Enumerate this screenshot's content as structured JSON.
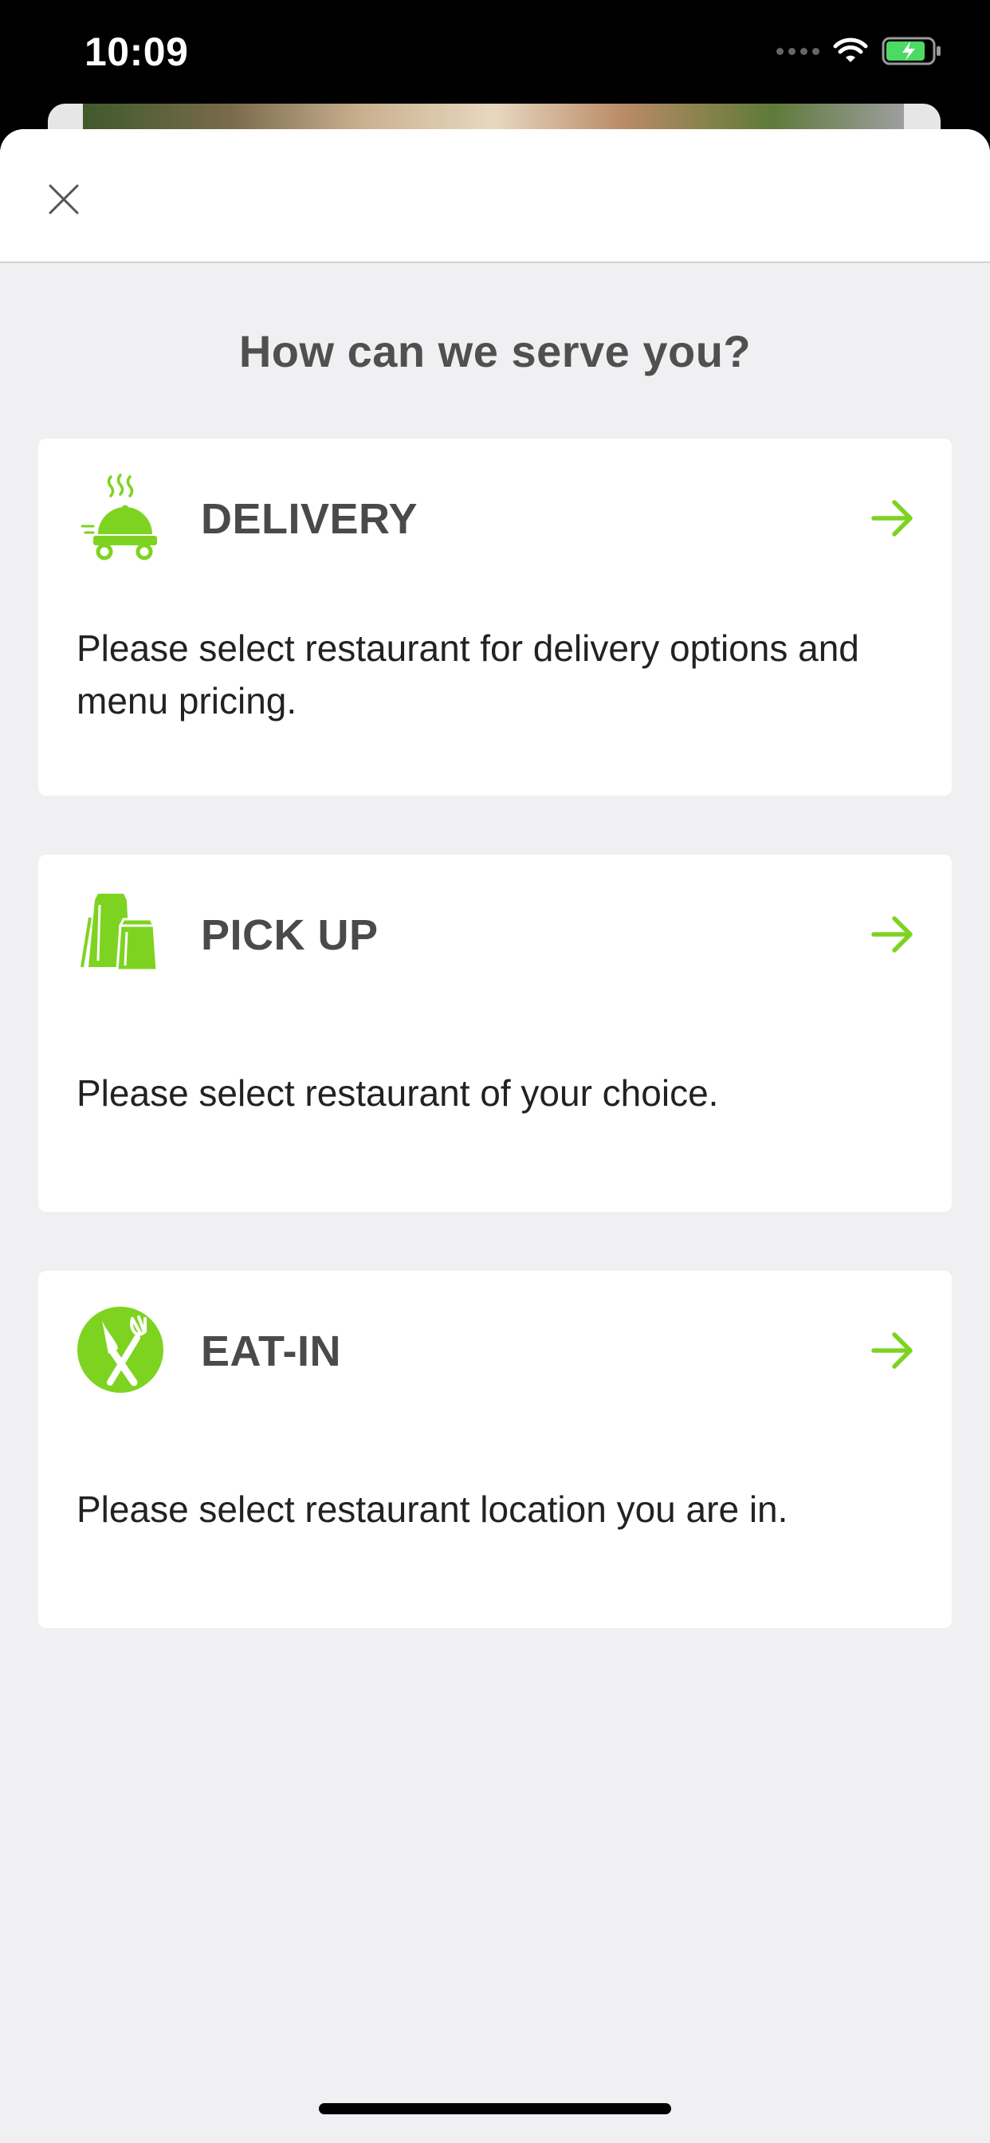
{
  "status_bar": {
    "time": "10:09",
    "icons": [
      "signal-dots-icon",
      "wifi-icon",
      "battery-charging-icon"
    ]
  },
  "sheet": {
    "close_icon": "close-icon",
    "heading": "How can we serve you?"
  },
  "options": [
    {
      "id": "delivery",
      "icon": "delivery-cloche-icon",
      "title": "DELIVERY",
      "description": "Please select restaurant for delivery options and menu pricing.",
      "arrow_icon": "arrow-right-icon"
    },
    {
      "id": "pickup",
      "icon": "shopping-bags-icon",
      "title": "PICK UP",
      "description": "Please select restaurant of your choice.",
      "arrow_icon": "arrow-right-icon"
    },
    {
      "id": "eatin",
      "icon": "fork-knife-icon",
      "title": "EAT-IN",
      "description": "Please select restaurant location you are in.",
      "arrow_icon": "arrow-right-icon"
    }
  ],
  "colors": {
    "accent": "#7ed321",
    "title_text": "#4a4a4a",
    "sheet_background": "#f0f0f2",
    "card_background": "#ffffff"
  }
}
